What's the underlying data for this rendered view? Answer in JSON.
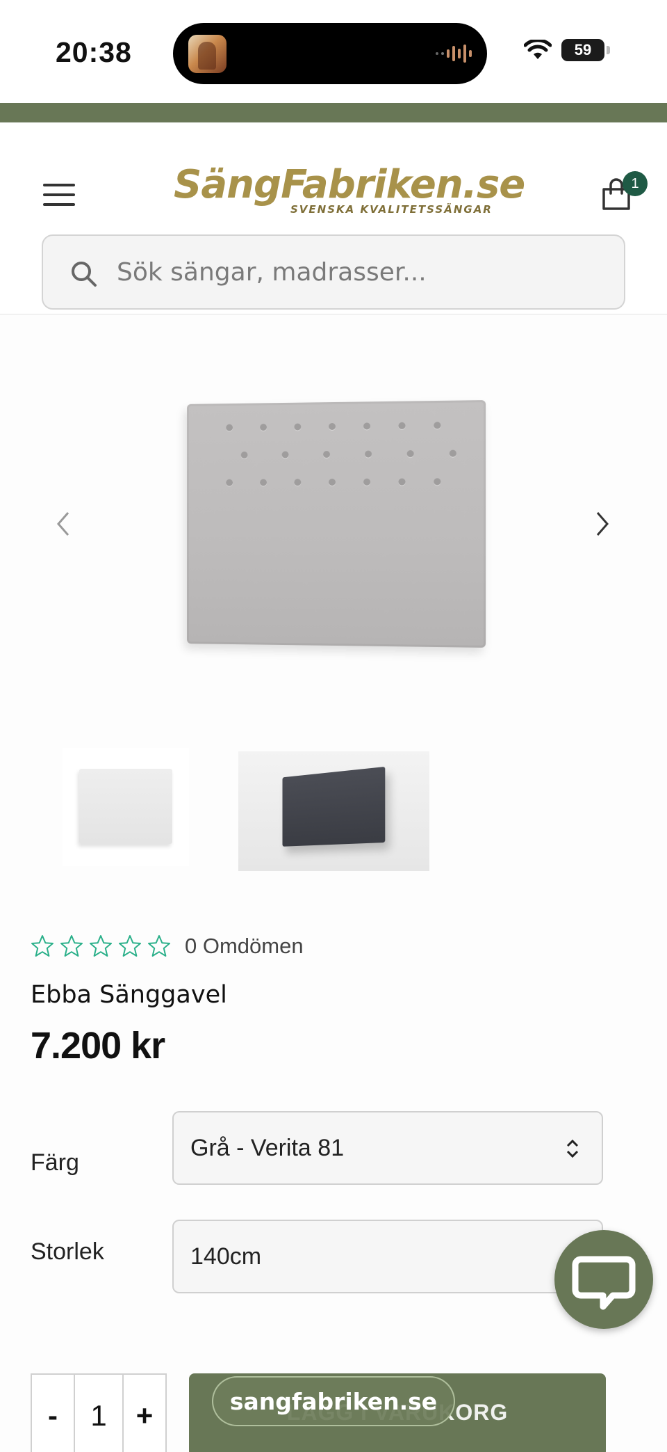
{
  "status_bar": {
    "time": "20:38",
    "battery": "59",
    "icons": [
      "wifi-icon",
      "battery-icon",
      "now-playing-artwork",
      "audio-waveform-icon"
    ]
  },
  "header": {
    "logo_main": "SängFabriken.se",
    "logo_tagline": "SVENSKA KVALITETSSÄNGAR",
    "cart_count": "1",
    "icons": [
      "hamburger-menu-icon",
      "shopping-bag-icon",
      "search-icon"
    ]
  },
  "search": {
    "placeholder": "Sök sängar, madrasser..."
  },
  "gallery": {
    "icons": [
      "chevron-left-icon",
      "chevron-right-icon"
    ],
    "thumbnails": [
      "Ljusgrå sänggavel",
      "Mörkgrå sänggavel"
    ]
  },
  "product": {
    "rating_count_text": "0 Omdömen",
    "stars_filled": 0,
    "stars_total": 5,
    "title": "Ebba Sänggavel",
    "price": "7.200 kr"
  },
  "options": {
    "color_label": "Färg",
    "color_value": "Grå - Verita 81",
    "size_label": "Storlek",
    "size_value": "140cm"
  },
  "cart_row": {
    "qty_minus": "-",
    "qty_value": "1",
    "qty_plus": "+",
    "add_label": "LÄGG I VARUKORG"
  },
  "browser": {
    "url": "sangfabriken.se"
  },
  "colors": {
    "brand_green": "#687756",
    "badge_green": "#1f5a45",
    "logo_gold": "#a8924a",
    "star_outline": "#2bb08a"
  }
}
